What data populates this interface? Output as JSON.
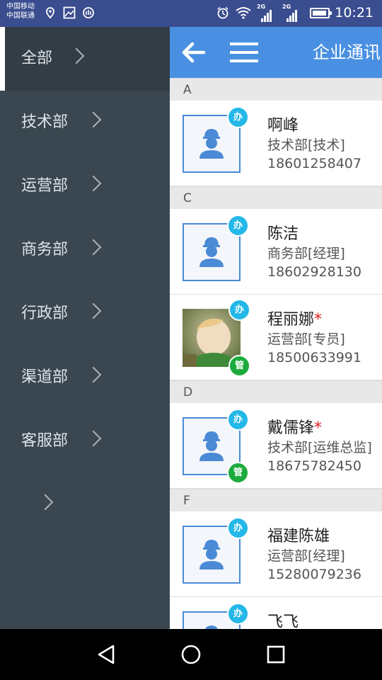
{
  "status_bar": {
    "carrier_1": "中国移动",
    "carrier_2": "中国联通",
    "net_1": "2G",
    "net_2": "2G",
    "time": "10:21"
  },
  "sidebar": {
    "items": [
      {
        "label": "全部"
      },
      {
        "label": "技术部"
      },
      {
        "label": "运营部"
      },
      {
        "label": "商务部"
      },
      {
        "label": "行政部"
      },
      {
        "label": "渠道部"
      },
      {
        "label": "客服部"
      },
      {
        "label": ""
      }
    ],
    "selected": "全部"
  },
  "header": {
    "title": "企业通讯"
  },
  "badges": {
    "office": "办",
    "admin": "管"
  },
  "contacts": {
    "sections": [
      {
        "letter": "A",
        "entries": [
          {
            "name": "啊峰",
            "starred": false,
            "dept": "技术部[技术]",
            "phone": "18601258407",
            "photo": false,
            "admin": false
          }
        ]
      },
      {
        "letter": "C",
        "entries": [
          {
            "name": "陈洁",
            "starred": false,
            "dept": "商务部[经理]",
            "phone": "18602928130",
            "photo": false,
            "admin": false
          },
          {
            "name": "程丽娜",
            "starred": true,
            "dept": "运营部[专员]",
            "phone": "18500633991",
            "photo": true,
            "admin": true
          }
        ]
      },
      {
        "letter": "D",
        "entries": [
          {
            "name": "戴儒锋",
            "starred": true,
            "dept": "技术部[运维总监]",
            "phone": "18675782450",
            "photo": false,
            "admin": true
          }
        ]
      },
      {
        "letter": "F",
        "entries": [
          {
            "name": "福建陈雄",
            "starred": false,
            "dept": "运营部[经理]",
            "phone": "15280079236",
            "photo": false,
            "admin": false
          },
          {
            "name": "飞飞",
            "starred": false,
            "dept": "",
            "phone": "",
            "photo": false,
            "admin": false
          }
        ]
      }
    ]
  },
  "colors": {
    "status_bar": "#3a4d8f",
    "app_bar": "#4a90e2",
    "sidebar": "#3a4750",
    "badge_office": "#23b8e8",
    "badge_admin": "#1bab3c",
    "star": "#e01d1d"
  },
  "icons": {
    "status": [
      "location-icon",
      "gallery-icon",
      "shield-icon",
      "alarm-icon",
      "wifi-icon",
      "signal-icon",
      "battery-icon"
    ],
    "app_bar": [
      "back-arrow-icon",
      "menu-icon"
    ],
    "nav": [
      "back-triangle-icon",
      "home-circle-icon",
      "recents-square-icon"
    ]
  }
}
